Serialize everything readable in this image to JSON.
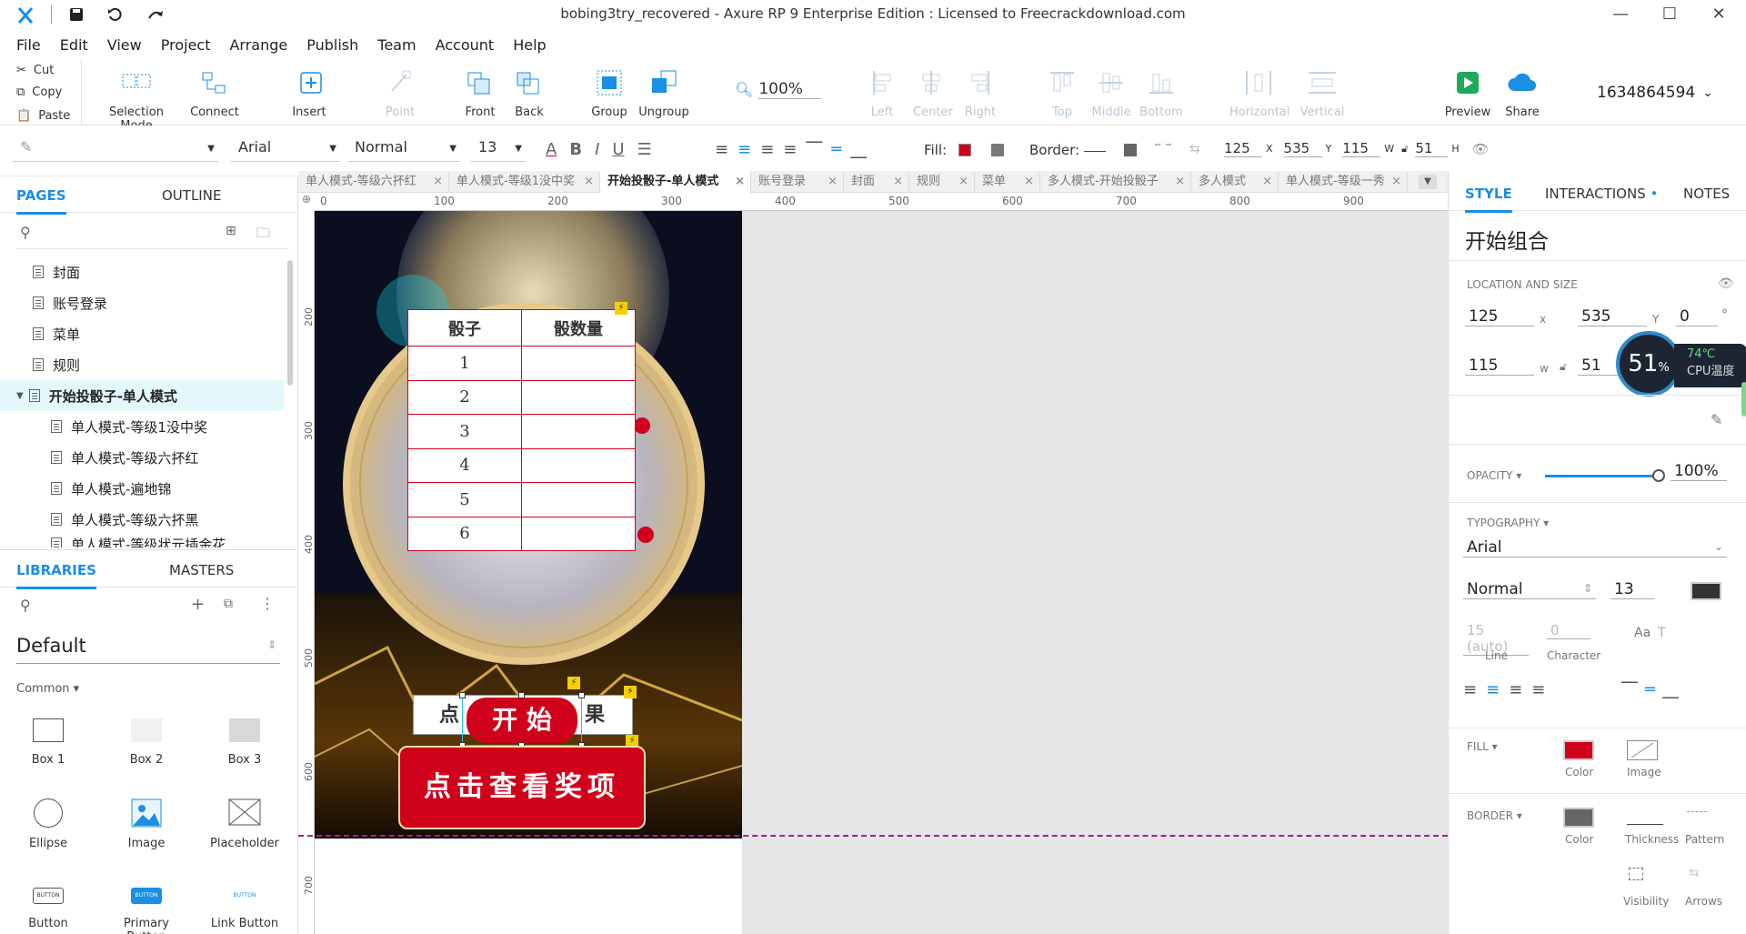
{
  "window": {
    "title": "bobing3try_recovered - Axure RP 9 Enterprise Edition : Licensed to Freecrackdownload.com"
  },
  "menu": [
    "File",
    "Edit",
    "View",
    "Project",
    "Arrange",
    "Publish",
    "Team",
    "Account",
    "Help"
  ],
  "clipboard": {
    "cut": "Cut",
    "copy": "Copy",
    "paste": "Paste"
  },
  "toolbar": {
    "selection_mode": "Selection Mode",
    "connect": "Connect",
    "insert": "Insert",
    "point": "Point",
    "front": "Front",
    "back": "Back",
    "group": "Group",
    "ungroup": "Ungroup",
    "zoom": "100%",
    "left": "Left",
    "center": "Center",
    "right": "Right",
    "top": "Top",
    "middle": "Middle",
    "bottom": "Bottom",
    "horizontal": "Horizontal",
    "vertical": "Vertical",
    "preview": "Preview",
    "share": "Share",
    "account": "1634864594"
  },
  "format": {
    "font": "Arial",
    "weight": "Normal",
    "size": "13",
    "fill_label": "Fill:",
    "border_label": "Border:",
    "x": "125",
    "y": "535",
    "w": "115",
    "h": "51",
    "x_l": "X",
    "y_l": "Y",
    "w_l": "W",
    "h_l": "H"
  },
  "left": {
    "tabs": {
      "pages": "PAGES",
      "outline": "OUTLINE"
    },
    "pages": [
      "封面",
      "账号登录",
      "菜单",
      "规则",
      "开始投骰子-单人模式"
    ],
    "subpages": [
      "单人模式-等级1没中奖",
      "单人模式-等级六抔红",
      "单人模式-遍地锦",
      "单人模式-等级六抔黑",
      "单人模式-等级状元插金花"
    ],
    "lib_tabs": {
      "libraries": "LIBRARIES",
      "masters": "MASTERS"
    },
    "library": "Default",
    "group": "Common ▾",
    "items": [
      "Box 1",
      "Box 2",
      "Box 3",
      "Ellipse",
      "Image",
      "Placeholder",
      "Button",
      "Primary Button",
      "Link Button"
    ],
    "btn_icon_text": "BUTTON"
  },
  "doc_tabs": [
    "单人模式-等级六抔红",
    "单人模式-等级1没中奖",
    "开始投骰子-单人模式",
    "账号登录",
    "封面",
    "规则",
    "菜单",
    "多人模式-开始投骰子",
    "多人模式",
    "单人模式-等级一秀"
  ],
  "ruler": {
    "h": [
      "0",
      "100",
      "200",
      "300",
      "400",
      "500",
      "600",
      "700",
      "800",
      "900"
    ],
    "v": [
      "200",
      "300",
      "400",
      "500",
      "600",
      "700"
    ]
  },
  "canvas": {
    "table_head": [
      "骰子",
      "骰数量"
    ],
    "rows": [
      "1",
      "2",
      "3",
      "4",
      "5",
      "6"
    ],
    "start_btn": "开 始",
    "behind_left": "点",
    "behind_right": "果",
    "prize_btn": "点击查看奖项"
  },
  "right": {
    "tabs": {
      "style": "STYLE",
      "interactions": "INTERACTIONS",
      "notes": "NOTES"
    },
    "name": "开始组合",
    "loc_label": "LOCATION AND SIZE",
    "x": "125",
    "y": "535",
    "rot": "0",
    "deg": "°",
    "w": "115",
    "h": "51",
    "x_l": "x",
    "y_l": "Y",
    "w_l": "w",
    "opacity_label": "OPACITY ▾",
    "opacity": "100%",
    "typo_label": "TYPOGRAPHY ▾",
    "font": "Arial",
    "weight": "Normal",
    "size": "13",
    "line_ph": "15 (auto)",
    "char_ph": "0",
    "line_l": "Line",
    "char_l": "Character",
    "fill_label": "FILL ▾",
    "fill_color": "Color",
    "fill_image": "Image",
    "border_label": "BORDER ▾",
    "border_color": "Color",
    "thickness": "Thickness",
    "pattern": "Pattern",
    "visibility": "Visibility",
    "arrows": "Arrows",
    "cpu_pct": "51",
    "cpu_pct_sign": "%",
    "cpu_temp": "74℃",
    "cpu_label": "CPU温度"
  },
  "colors": {
    "accent": "#1a8fe3",
    "red": "#d0021b",
    "dashed": "#a020a0"
  }
}
